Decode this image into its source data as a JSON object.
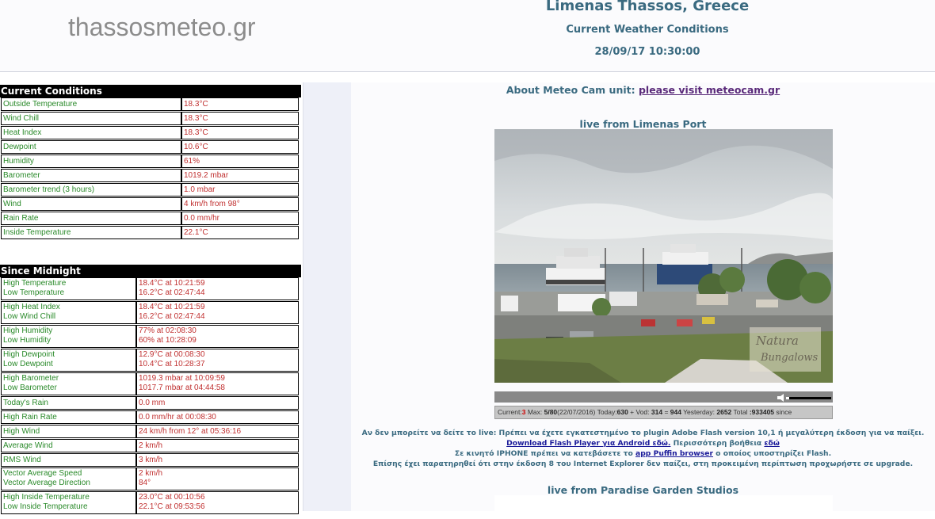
{
  "header": {
    "logo": "thassosmeteo.gr",
    "title": "Limenas Thassos, Greece",
    "subtitle": "Current Weather Conditions",
    "datetime": "28/09/17 10:30:00"
  },
  "current": {
    "heading": "Current Conditions",
    "rows": [
      {
        "label": "Outside Temperature",
        "value": "18.3°C"
      },
      {
        "label": "Wind Chill",
        "value": "18.3°C"
      },
      {
        "label": "Heat Index",
        "value": "18.3°C"
      },
      {
        "label": "Dewpoint",
        "value": "10.6°C"
      },
      {
        "label": "Humidity",
        "value": "61%"
      },
      {
        "label": "Barometer",
        "value": "1019.2 mbar"
      },
      {
        "label": "Barometer trend (3 hours)",
        "value": "1.0 mbar"
      },
      {
        "label": "Wind",
        "value": "4 km/h from 98°"
      },
      {
        "label": "Rain Rate",
        "value": "0.0 mm/hr"
      },
      {
        "label": "Inside Temperature",
        "value": "22.1°C"
      }
    ]
  },
  "midnight": {
    "heading": "Since Midnight",
    "rows": [
      {
        "label": "High Temperature",
        "label2": "Low Temperature",
        "value": "18.4°C at 10:21:59",
        "value2": "16.2°C at 02:47:44"
      },
      {
        "label": "High Heat Index",
        "label2": "Low Wind Chill",
        "value": "18.4°C at 10:21:59",
        "value2": "16.2°C at 02:47:44"
      },
      {
        "label": "High Humidity",
        "label2": "Low Humidity",
        "value": "77% at 02:08:30",
        "value2": "60% at 10:28:09"
      },
      {
        "label": "High Dewpoint",
        "label2": "Low Dewpoint",
        "value": "12.9°C at 00:08:30",
        "value2": "10.4°C at 10:28:37"
      },
      {
        "label": "High Barometer",
        "label2": "Low Barometer",
        "value": "1019.3 mbar at 10:09:59",
        "value2": "1017.7 mbar at 04:44:58"
      },
      {
        "label": "Today's Rain",
        "value": "0.0 mm"
      },
      {
        "label": "High Rain Rate",
        "value": "0.0 mm/hr at 00:08:30"
      },
      {
        "label": "High Wind",
        "value": "24 km/h from 12° at 05:36:16"
      },
      {
        "label": "Average Wind",
        "value": "2 km/h"
      },
      {
        "label": "RMS Wind",
        "value": "3 km/h"
      },
      {
        "label": "Vector Average Speed",
        "label2": "Vector Average Direction",
        "value": "2 km/h",
        "value2": "84°"
      },
      {
        "label": "High Inside Temperature",
        "label2": "Low Inside Temperature",
        "value": "23.0°C at 00:10:56",
        "value2": "22.1°C at 09:53:56"
      }
    ]
  },
  "main": {
    "about_prefix": "About Meteo Cam unit: ",
    "about_link": "please visit meteocam.gr",
    "live1": "live from Limenas Port",
    "cam_watermark1": "Natura",
    "cam_watermark2": "Bungalows",
    "stats": {
      "current_label": "Current:",
      "current_value": "3",
      "max_label": " Max: ",
      "max_value": "5/80",
      "max_date": "(22/07/2016)",
      "today_label": " Today:",
      "today_value": "630",
      "vod_label": " + Vod: ",
      "vod_value": "314",
      "eq_label": " = ",
      "eq_value": "944",
      "yesterday_label": " Yesterday: ",
      "yesterday_value": "2652",
      "total_label": " Total ",
      "total_value": ":933405",
      "since": " since"
    },
    "info": {
      "line1": "Αν δεν μπορείτε να δείτε το live: Πρέπει να έχετε εγκατεστημένο το plugin Adobe Flash version 10,1 ή μεγαλύτερη έκδοση για να παίξει.",
      "line2_link": "Download Flash Player για Android εδώ.",
      "line2_mid": " Περισσότερη βοήθεια ",
      "line2_link2": "εδώ",
      "line3_pre": "Σε κινητό IPHONE πρέπει να κατεβάσετε το ",
      "line3_link": "app Puffin browser",
      "line3_post": " ο οποίος υποστηρίζει Flash.",
      "line4": "Επίσης έχει παρατηρηθεί ότι στην έκδοση 8 του Internet Explorer δεν παίζει, στη προκειμένη περίπτωση προχωρήστε σε upgrade."
    },
    "live2": "live from Paradise Garden Studios"
  }
}
